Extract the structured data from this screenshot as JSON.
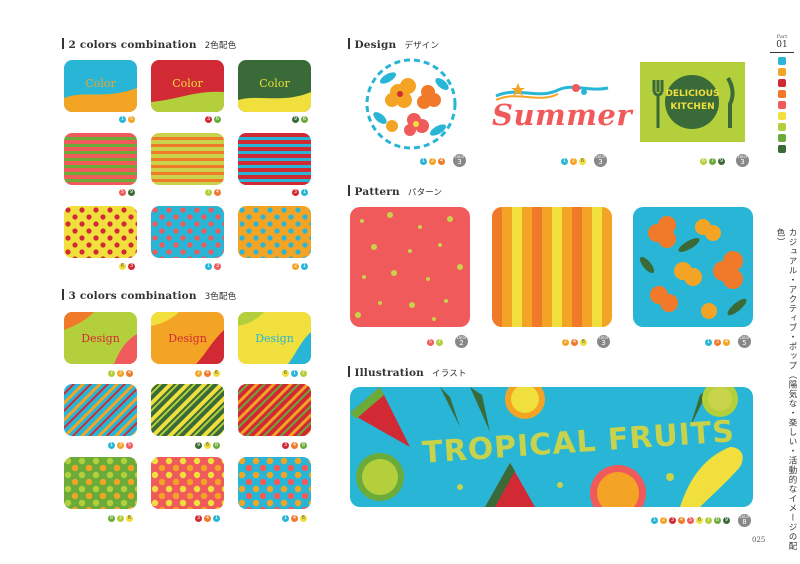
{
  "sections": {
    "two_colors": {
      "title": "2 colors combination",
      "jp": "2色配色"
    },
    "three_colors": {
      "title": "3 colors combination",
      "jp": "3色配色"
    },
    "design": {
      "title": "Design",
      "jp": "デザイン"
    },
    "pattern": {
      "title": "Pattern",
      "jp": "パターン"
    },
    "illustration": {
      "title": "Illustration",
      "jp": "イラスト"
    }
  },
  "swatch_labels": {
    "color": "Color",
    "design": "Design"
  },
  "design_texts": {
    "summer": "Summer",
    "kitchen_line1": "DELICIOUS",
    "kitchen_line2": "KITCHEN"
  },
  "illustration_text": "TROPICAL FRUITS",
  "badge": {
    "top": "color",
    "numbers": [
      "3",
      "3",
      "3",
      "2",
      "3",
      "5",
      "8"
    ]
  },
  "two_colors_codes": [
    [
      "1",
      "5"
    ],
    [
      "3",
      "6"
    ],
    [
      "9",
      "6"
    ],
    [
      "5",
      "9"
    ],
    [
      "7",
      "4"
    ],
    [
      "3",
      "1"
    ],
    [
      "6",
      "3"
    ],
    [
      "1",
      "3"
    ],
    [
      "2",
      "1"
    ]
  ],
  "three_colors_codes": [
    [
      "7",
      "2",
      "4"
    ],
    [
      "2",
      "4",
      "6"
    ],
    [
      "6",
      "1",
      "7"
    ],
    [
      "1",
      "3",
      "5"
    ],
    [
      "9",
      "6",
      "8"
    ],
    [
      "3",
      "4",
      "8"
    ],
    [
      "8",
      "7",
      "6"
    ],
    [
      "3",
      "4",
      "1"
    ],
    [
      "1",
      "4",
      "6"
    ]
  ],
  "design_codes": [
    [
      "1",
      "2",
      "4"
    ],
    [
      "1",
      "2",
      "6"
    ],
    [
      "6",
      "7",
      "9"
    ]
  ],
  "pattern_codes": [
    [
      "5",
      "7"
    ],
    [
      "2",
      "4",
      "6"
    ],
    [
      "1",
      "3",
      "4"
    ]
  ],
  "illustration_codes": [
    "1",
    "2",
    "3",
    "4",
    "5",
    "6",
    "7",
    "8",
    "9"
  ],
  "sidebar": {
    "part_label": "Part",
    "part_number": "01",
    "vertical_text": "カジュアル・アクティブ・ポップ（陽気な・楽しい・活動的なイメージの配色）"
  },
  "page_number": "025",
  "palette": {
    "1": "#29b6d6",
    "2": "#f4a424",
    "3": "#d22a35",
    "4": "#f07a2a",
    "5": "#f05a5a",
    "6": "#f0df3c",
    "7": "#b4cf3c",
    "8": "#6aab3a",
    "9": "#3a6a38"
  }
}
